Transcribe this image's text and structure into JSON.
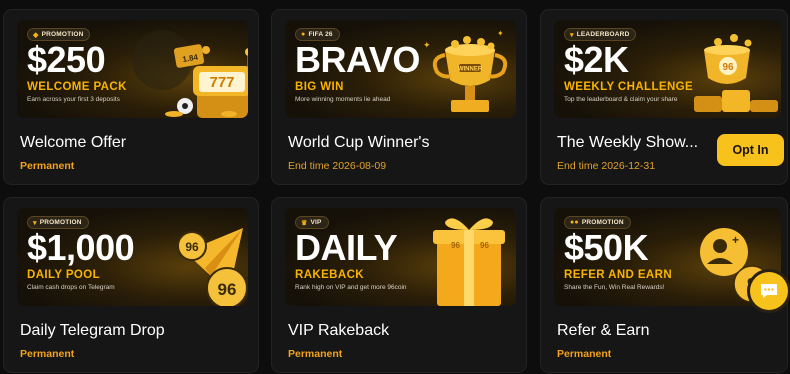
{
  "cards": [
    {
      "tag": "PROMOTION",
      "tag_icon": "gift-icon",
      "headline": "$250",
      "subline": "WELCOME PACK",
      "desc": "Earn across your first 3 deposits",
      "art_text": "777",
      "art_odds": "1.84",
      "title": "Welcome Offer",
      "status": "Permanent"
    },
    {
      "tag": "FIFA 26",
      "tag_icon": "fifa-icon",
      "headline": "BRAVO",
      "subline": "BIG WIN",
      "desc": "More winning moments lie ahead",
      "art_text": "WINNER",
      "title": "World Cup Winner's",
      "status": "End time 2026-08-09"
    },
    {
      "tag": "LEADERBOARD",
      "tag_icon": "trophy-icon",
      "headline": "$2K",
      "subline": "WEEKLY CHALLENGE",
      "desc": "Top the leaderboard & claim your share",
      "title": "The Weekly Show...",
      "status": "End time 2026-12-31",
      "button": "Opt In"
    },
    {
      "tag": "PROMOTION",
      "tag_icon": "trophy-icon",
      "headline": "$1,000",
      "subline": "DAILY POOL",
      "desc": "Claim cash drops on Telegram",
      "title": "Daily Telegram Drop",
      "status": "Permanent"
    },
    {
      "tag": "VIP",
      "tag_icon": "crown-icon",
      "headline": "DAILY",
      "subline": "RAKEBACK",
      "desc": "Rank high on VIP and get more 96coin",
      "title": "VIP Rakeback",
      "status": "Permanent"
    },
    {
      "tag": "PROMOTION",
      "tag_icon": "link-icon",
      "headline": "$50K",
      "subline": "REFER AND EARN",
      "desc": "Share the Fun, Win Real Rewards!",
      "title": "Refer & Earn",
      "status": "Permanent"
    }
  ],
  "chat": {
    "icon": "chat-icon"
  },
  "colors": {
    "accent": "#f8c21d",
    "status": "#f3a21a",
    "card_bg": "#161617"
  }
}
